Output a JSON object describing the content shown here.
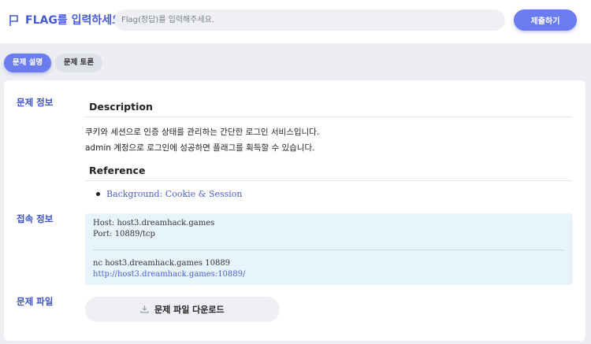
{
  "header": {
    "flag_title": "FLAG를 입력하세요",
    "flag_placeholder": "Flag(정답)를 입력해주세요.",
    "submit_label": "제출하기",
    "accent_color": "#6b7cf0",
    "icons": [
      "flag-icon"
    ]
  },
  "tabs": [
    {
      "label": "문제 설명",
      "active": true
    },
    {
      "label": "문제 토론",
      "active": false
    }
  ],
  "sections": {
    "problem_info": {
      "label": "문제 정보",
      "description_heading": "Description",
      "description_lines": [
        "쿠키와 세션으로 인증 상태를 관리하는 간단한 로그인 서비스입니다.",
        "admin 계정으로 로그인에 성공하면 플래그를 획득할 수 있습니다."
      ],
      "reference_heading": "Reference",
      "references": [
        "Background: Cookie & Session"
      ]
    },
    "connection_info": {
      "label": "접속 정보",
      "host": "Host: host3.dreamhack.games",
      "port": "Port: 10889/tcp",
      "nc_command": "nc host3.dreamhack.games 10889",
      "url": "http://host3.dreamhack.games:10889/"
    },
    "problem_file": {
      "label": "문제 파일",
      "download_label": "문제 파일 다운로드",
      "icon": "download-icon"
    }
  }
}
